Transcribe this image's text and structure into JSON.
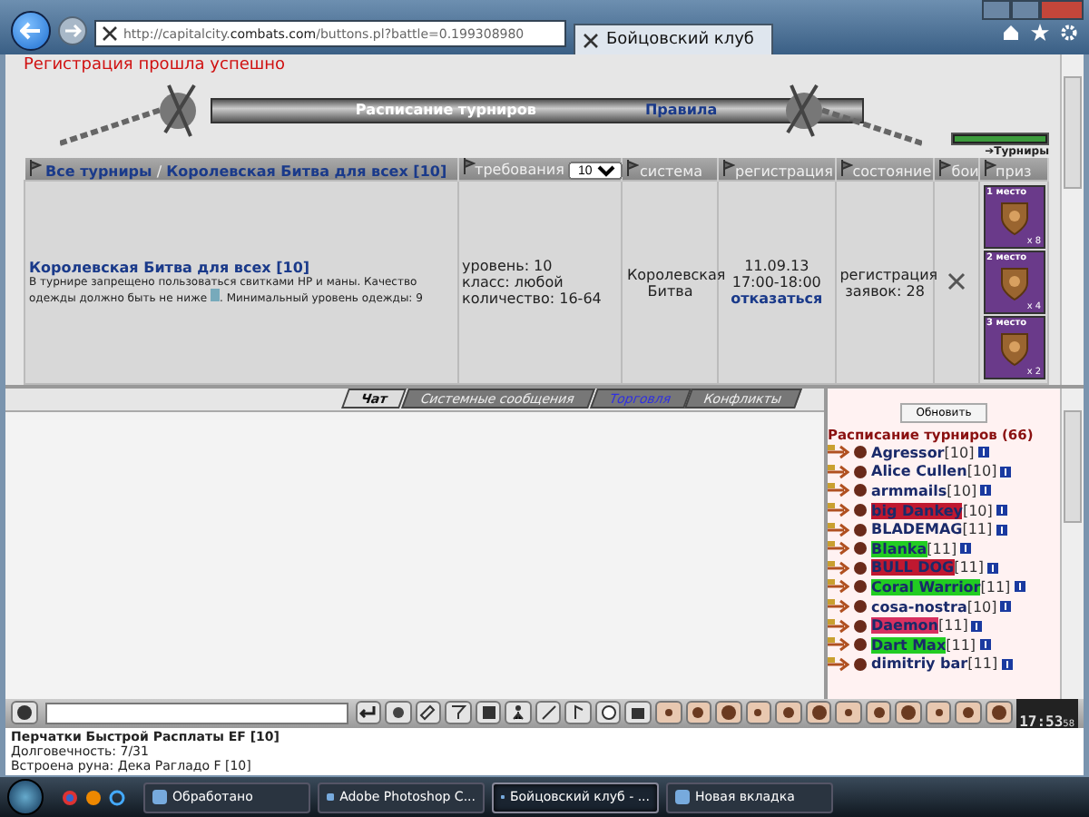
{
  "browser": {
    "url": "http://capitalcity.**combats.com**/buttons.pl?battle=0.199308980",
    "tab_title": "Бойцовский клуб"
  },
  "page": {
    "notice": "Регистрация прошла успешно",
    "banner_title": "Расписание турниров",
    "rules_link": "Правила",
    "tournaments_link": "➔Турниры"
  },
  "table": {
    "crumb_all": "Все турниры",
    "crumb_sep": "/",
    "crumb_current": "Королевская Битва для всех [10]",
    "columns": [
      "требования",
      "система",
      "регистрация",
      "состояние",
      "бои",
      "приз"
    ],
    "level_filter": "10",
    "row": {
      "title": "Королевская Битва для всех [10]",
      "desc_before": "В турнире запрещено пользоваться свитками HP и маны. Качество одежды должно быть не ниже",
      "desc_after": ". Минимальный уровень одежды: 9",
      "requirements": [
        "уровень: 10",
        "класс: любой",
        "количество: 16-64"
      ],
      "system": "Королевская Битва",
      "registration": "11.09.13 17:00-18:00",
      "cancel_link": "отказаться",
      "status": [
        "регистрация",
        "заявок: 28"
      ],
      "prizes": [
        {
          "place": "1 место",
          "count": "x 8"
        },
        {
          "place": "2 место",
          "count": "x 4"
        },
        {
          "place": "3 место",
          "count": "x 2"
        }
      ]
    }
  },
  "chat_tabs": [
    {
      "label": "Чат",
      "selected": true,
      "highlighted": false
    },
    {
      "label": "Системные сообщения",
      "selected": false,
      "highlighted": false
    },
    {
      "label": "Торговля",
      "selected": false,
      "highlighted": true
    },
    {
      "label": "Конфликты",
      "selected": false,
      "highlighted": false
    }
  ],
  "side": {
    "refresh_button": "Обновить",
    "title": "Расписание турниров (66)",
    "players": [
      {
        "name": "Agressor",
        "level": "[10]"
      },
      {
        "name": "Alice Cullen",
        "level": "[10]"
      },
      {
        "name": "armmails",
        "level": "[10]"
      },
      {
        "name": "big Dankey",
        "level": "[10]",
        "color": "#c01830"
      },
      {
        "name": "BLADEMAG",
        "level": "[11]"
      },
      {
        "name": "Blanka",
        "level": "[11]",
        "color": "#22cc22"
      },
      {
        "name": "BULL DOG",
        "level": "[11]",
        "color": "#c01830"
      },
      {
        "name": "Coral Warrior",
        "level": "[11]",
        "color": "#22cc22"
      },
      {
        "name": "cosa-nostra",
        "level": "[10]"
      },
      {
        "name": "Daemon",
        "level": "[11]",
        "color": "#d83060"
      },
      {
        "name": "Dart Max",
        "level": "[11]",
        "color": "#22cc22"
      },
      {
        "name": "dimitriy bar",
        "level": "[11]"
      }
    ]
  },
  "clock": {
    "time": "17:53",
    "seconds": "58"
  },
  "item_info": {
    "name": "Перчатки Быстрой Расплаты EF [10]",
    "lines": [
      "Долговечность: 7/31",
      "Встроена руна: Дека Рагладо F [10]"
    ]
  },
  "taskbar": {
    "items": [
      {
        "label": "Обработано",
        "selected": false
      },
      {
        "label": "Adobe Photoshop C...",
        "selected": false
      },
      {
        "label": "Бойцовский клуб - ...",
        "selected": true
      },
      {
        "label": "Новая вкладка",
        "selected": false
      }
    ]
  }
}
